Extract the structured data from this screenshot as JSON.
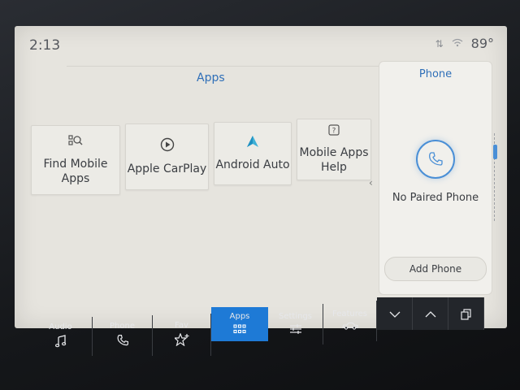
{
  "status": {
    "time": "2:13",
    "temperature": "89°"
  },
  "page": {
    "title": "Apps"
  },
  "tiles": [
    {
      "label": "Find Mobile Apps",
      "icon": "search-apps-icon"
    },
    {
      "label": "Apple CarPlay",
      "icon": "carplay-icon"
    },
    {
      "label": "Android Auto",
      "icon": "android-auto-icon"
    },
    {
      "label": "Mobile Apps Help",
      "icon": "help-icon"
    }
  ],
  "phone_panel": {
    "title": "Phone",
    "status_text": "No Paired Phone",
    "add_button_label": "Add Phone"
  },
  "nav": {
    "items": [
      {
        "label": "Audio",
        "icon": "music-note-icon"
      },
      {
        "label": "Phone",
        "icon": "phone-icon"
      },
      {
        "label": "Fav",
        "icon": "star-plus-icon"
      },
      {
        "label": "Apps",
        "icon": "grid-icon",
        "active": true
      },
      {
        "label": "Settings",
        "icon": "sliders-icon"
      },
      {
        "label": "Features",
        "icon": "car-icon"
      }
    ]
  },
  "colors": {
    "accent": "#1e7ad6",
    "title_blue": "#2f6fb8",
    "screen_bg": "#e6e4de"
  }
}
